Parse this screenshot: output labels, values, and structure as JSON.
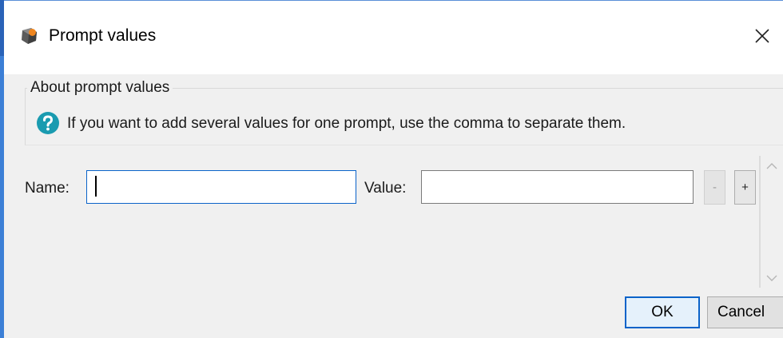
{
  "window": {
    "title": "Prompt values",
    "app_icon": "app-logo-icon",
    "close_icon": "close-icon"
  },
  "about": {
    "legend": "About prompt values",
    "icon": "question-mark-icon",
    "text": "If you want to add several values for one prompt, use the comma to separate them."
  },
  "form": {
    "name_label": "Name:",
    "name_value": "",
    "value_label": "Value:",
    "value_value": "",
    "remove_label": "-",
    "add_label": "+"
  },
  "buttons": {
    "ok": "OK",
    "cancel": "Cancel"
  },
  "colors": {
    "accent": "#0a63c9",
    "help_icon": "#1a9bb0",
    "dialog_background": "#f0f0f0"
  }
}
